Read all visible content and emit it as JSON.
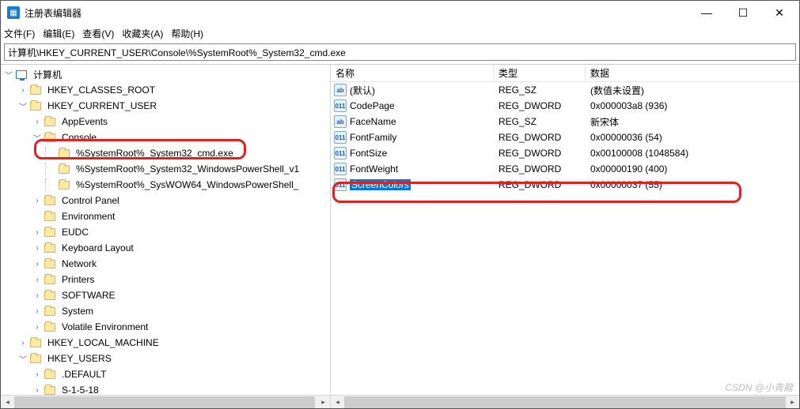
{
  "window": {
    "title": "注册表编辑器",
    "min": "—",
    "max": "☐",
    "close": "✕"
  },
  "menu": {
    "file": "文件(F)",
    "edit": "编辑(E)",
    "view": "查看(V)",
    "fav": "收藏夹(A)",
    "help": "帮助(H)"
  },
  "path": "计算机\\HKEY_CURRENT_USER\\Console\\%SystemRoot%_System32_cmd.exe",
  "tree": {
    "root": "计算机",
    "hkcr": "HKEY_CLASSES_ROOT",
    "hkcu": "HKEY_CURRENT_USER",
    "appevents": "AppEvents",
    "console": "Console",
    "k_cmd": "%SystemRoot%_System32_cmd.exe",
    "k_ps": "%SystemRoot%_System32_WindowsPowerShell_v1",
    "k_ps64": "%SystemRoot%_SysWOW64_WindowsPowerShell_",
    "cpl": "Control Panel",
    "env": "Environment",
    "eudc": "EUDC",
    "kbd": "Keyboard Layout",
    "net": "Network",
    "prn": "Printers",
    "sw": "SOFTWARE",
    "sys": "System",
    "volenv": "Volatile Environment",
    "hklm": "HKEY_LOCAL_MACHINE",
    "hku": "HKEY_USERS",
    "def": ".DEFAULT",
    "s1518": "S-1-5-18"
  },
  "cols": {
    "name": "名称",
    "type": "类型",
    "data": "数据"
  },
  "rows": [
    {
      "icon": "ab",
      "name": "(默认)",
      "type": "REG_SZ",
      "data": "(数值未设置)"
    },
    {
      "icon": "01",
      "name": "CodePage",
      "type": "REG_DWORD",
      "data": "0x000003a8 (936)"
    },
    {
      "icon": "ab",
      "name": "FaceName",
      "type": "REG_SZ",
      "data": "新宋体"
    },
    {
      "icon": "01",
      "name": "FontFamily",
      "type": "REG_DWORD",
      "data": "0x00000036 (54)"
    },
    {
      "icon": "01",
      "name": "FontSize",
      "type": "REG_DWORD",
      "data": "0x00100008 (1048584)"
    },
    {
      "icon": "01",
      "name": "FontWeight",
      "type": "REG_DWORD",
      "data": "0x00000190 (400)"
    },
    {
      "icon": "01",
      "name": "ScreenColors",
      "type": "REG_DWORD",
      "data": "0x00000037 (55)",
      "sel": true
    }
  ],
  "watermark": "CSDN @小青龍"
}
